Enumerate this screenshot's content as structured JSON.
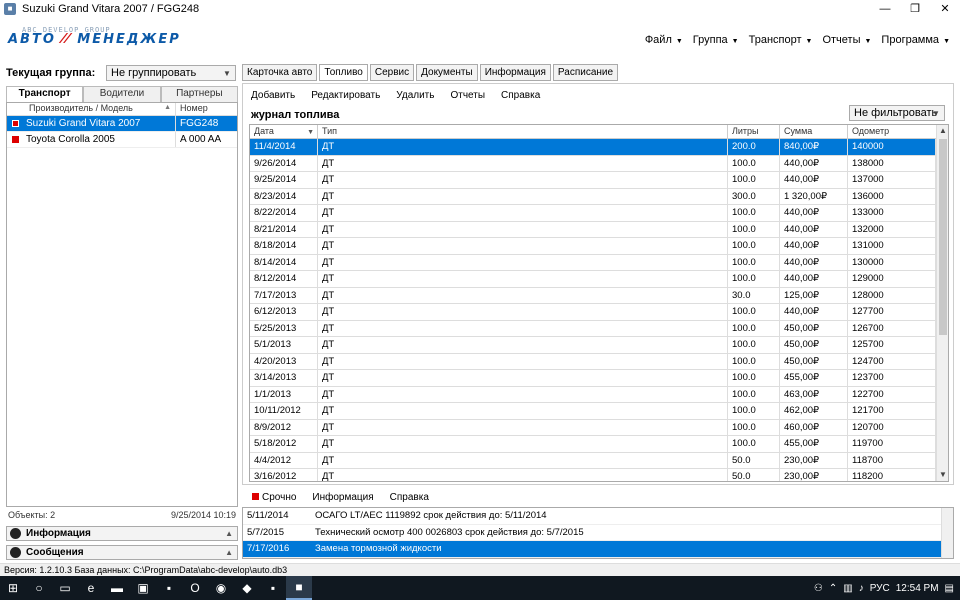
{
  "window": {
    "title": "Suzuki Grand Vitara 2007 / FGG248",
    "minimize": "—",
    "maximize": "❐",
    "close": "✕"
  },
  "logo": {
    "small": "ABC DEVELOP GROUP",
    "left": "АВТО",
    "right": "МЕНЕДЖЕР"
  },
  "menu": [
    {
      "label": "Файл"
    },
    {
      "label": "Группа"
    },
    {
      "label": "Транспорт"
    },
    {
      "label": "Отчеты"
    },
    {
      "label": "Программа"
    }
  ],
  "left": {
    "group_label": "Текущая группа:",
    "group_value": "Не группировать",
    "tabs": [
      "Транспорт",
      "Водители",
      "Партнеры"
    ],
    "columns": [
      "Производитель / Модель",
      "Номер"
    ],
    "rows": [
      {
        "model": "Suzuki Grand Vitara 2007",
        "number": "FGG248",
        "selected": true
      },
      {
        "model": "Toyota Corolla 2005",
        "number": "A 000 AA",
        "selected": false
      }
    ],
    "objects": "Объекты: 2",
    "date": "9/25/2014 10:19",
    "accordion": [
      "Информация",
      "Сообщения"
    ]
  },
  "right": {
    "tabs": [
      "Карточка авто",
      "Топливо",
      "Сервис",
      "Документы",
      "Информация",
      "Расписание"
    ],
    "active_tab": 1,
    "toolbar": [
      "Добавить",
      "Редактировать",
      "Удалить",
      "Отчеты",
      "Справка"
    ],
    "journal_title": "журнал топлива",
    "filter_value": "Не фильтровать",
    "columns": {
      "date": "Дата",
      "type": "Тип",
      "liters": "Литры",
      "sum": "Сумма",
      "odometer": "Одометр"
    },
    "rows": [
      {
        "date": "11/4/2014",
        "type": "ДТ",
        "liters": "200.0",
        "sum": "840,00₽",
        "odometer": "140000"
      },
      {
        "date": "9/26/2014",
        "type": "ДТ",
        "liters": "100.0",
        "sum": "440,00₽",
        "odometer": "138000"
      },
      {
        "date": "9/25/2014",
        "type": "ДТ",
        "liters": "100.0",
        "sum": "440,00₽",
        "odometer": "137000"
      },
      {
        "date": "8/23/2014",
        "type": "ДТ",
        "liters": "300.0",
        "sum": "1 320,00₽",
        "odometer": "136000"
      },
      {
        "date": "8/22/2014",
        "type": "ДТ",
        "liters": "100.0",
        "sum": "440,00₽",
        "odometer": "133000"
      },
      {
        "date": "8/21/2014",
        "type": "ДТ",
        "liters": "100.0",
        "sum": "440,00₽",
        "odometer": "132000"
      },
      {
        "date": "8/18/2014",
        "type": "ДТ",
        "liters": "100.0",
        "sum": "440,00₽",
        "odometer": "131000"
      },
      {
        "date": "8/14/2014",
        "type": "ДТ",
        "liters": "100.0",
        "sum": "440,00₽",
        "odometer": "130000"
      },
      {
        "date": "8/12/2014",
        "type": "ДТ",
        "liters": "100.0",
        "sum": "440,00₽",
        "odometer": "129000"
      },
      {
        "date": "7/17/2013",
        "type": "ДТ",
        "liters": "30.0",
        "sum": "125,00₽",
        "odometer": "128000"
      },
      {
        "date": "6/12/2013",
        "type": "ДТ",
        "liters": "100.0",
        "sum": "440,00₽",
        "odometer": "127700"
      },
      {
        "date": "5/25/2013",
        "type": "ДТ",
        "liters": "100.0",
        "sum": "450,00₽",
        "odometer": "126700"
      },
      {
        "date": "5/1/2013",
        "type": "ДТ",
        "liters": "100.0",
        "sum": "450,00₽",
        "odometer": "125700"
      },
      {
        "date": "4/20/2013",
        "type": "ДТ",
        "liters": "100.0",
        "sum": "450,00₽",
        "odometer": "124700"
      },
      {
        "date": "3/14/2013",
        "type": "ДТ",
        "liters": "100.0",
        "sum": "455,00₽",
        "odometer": "123700"
      },
      {
        "date": "1/1/2013",
        "type": "ДТ",
        "liters": "100.0",
        "sum": "463,00₽",
        "odometer": "122700"
      },
      {
        "date": "10/11/2012",
        "type": "ДТ",
        "liters": "100.0",
        "sum": "462,00₽",
        "odometer": "121700"
      },
      {
        "date": "8/9/2012",
        "type": "ДТ",
        "liters": "100.0",
        "sum": "460,00₽",
        "odometer": "120700"
      },
      {
        "date": "5/18/2012",
        "type": "ДТ",
        "liters": "100.0",
        "sum": "455,00₽",
        "odometer": "119700"
      },
      {
        "date": "4/4/2012",
        "type": "ДТ",
        "liters": "50.0",
        "sum": "230,00₽",
        "odometer": "118700"
      },
      {
        "date": "3/16/2012",
        "type": "ДТ",
        "liters": "50.0",
        "sum": "230,00₽",
        "odometer": "118200"
      }
    ]
  },
  "notices": {
    "tabs": [
      "Срочно",
      "Информация",
      "Справка"
    ],
    "rows": [
      {
        "date": "5/11/2014",
        "text": "ОСАГО LT/AEC 1119892 срок действия до: 5/11/2014",
        "selected": false
      },
      {
        "date": "5/7/2015",
        "text": "Технический осмотр 400 0026803 срок действия до: 5/7/2015",
        "selected": false
      },
      {
        "date": "7/17/2016",
        "text": "Замена тормозной жидкости",
        "selected": true
      }
    ]
  },
  "status": "Версия: 1.2.10.3 База данных: C:\\ProgramData\\abc-develop\\auto.db3",
  "taskbar": {
    "lang": "РУС",
    "time": "12:54 PM"
  },
  "colors": {
    "selection": "#0078d7",
    "brand_blue": "#0d5aa8",
    "brand_red": "#d51b1b"
  }
}
